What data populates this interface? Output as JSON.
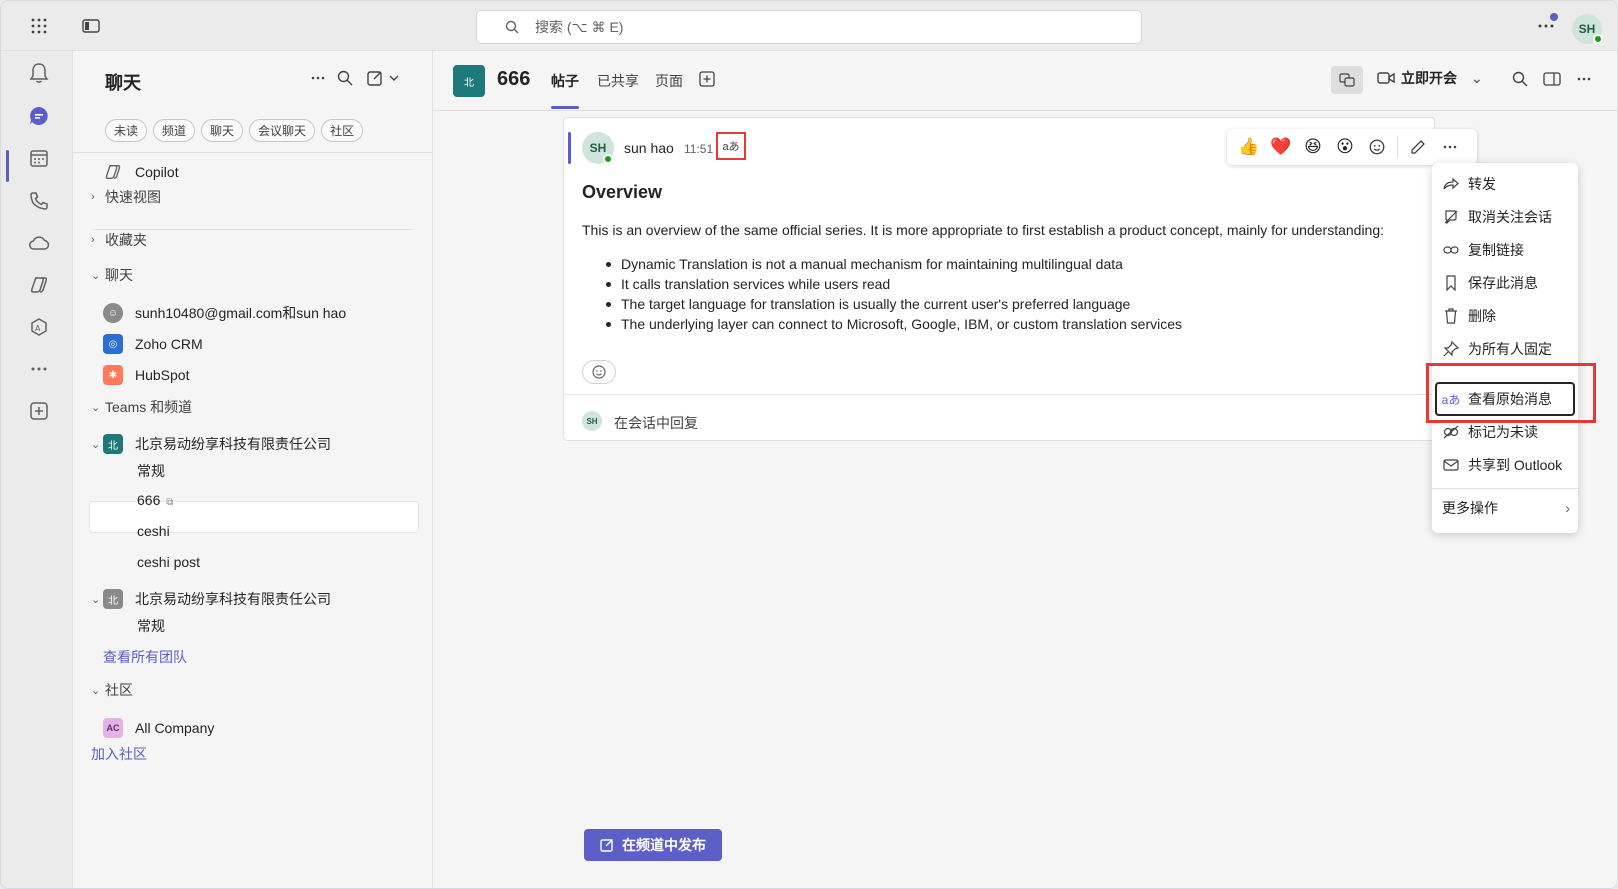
{
  "titlebar": {
    "search_placeholder": "搜索 (⌥ ⌘ E)",
    "user_initials": "SH"
  },
  "left_pane": {
    "title": "聊天",
    "filters": [
      "未读",
      "频道",
      "聊天",
      "会议聊天",
      "社区"
    ],
    "copilot": "Copilot",
    "quick_views": "快速视图",
    "favorites": "收藏夹",
    "chats_section": "聊天",
    "chats": [
      {
        "label": "sunh10480@gmail.com和sun hao"
      },
      {
        "label": "Zoho CRM"
      },
      {
        "label": "HubSpot"
      }
    ],
    "teams_section": "Teams 和频道",
    "team1": {
      "name": "北京易动纷享科技有限责任公司",
      "badge": "北"
    },
    "team1_channels": [
      "常规",
      "666",
      "ceshi",
      "ceshi post"
    ],
    "team2": {
      "name": "北京易动纷享科技有限责任公司",
      "badge": "北"
    },
    "team2_channels": [
      "常规"
    ],
    "see_all_teams": "查看所有团队",
    "community_section": "社区",
    "community": {
      "name": "All Company",
      "badge": "AC"
    },
    "join_community": "加入社区"
  },
  "channel": {
    "badge": "北",
    "name": "666",
    "tabs": [
      "帖子",
      "已共享",
      "页面"
    ],
    "meet_now": "立即开会"
  },
  "post": {
    "author_initials": "SH",
    "author": "sun hao",
    "time": "11:51",
    "title": "Overview",
    "intro": "This is an overview of the same official series. It is more appropriate to first establish a product concept, mainly for understanding:",
    "bullets": [
      "Dynamic Translation is not a manual mechanism for maintaining multilingual data",
      "It calls translation services while users read",
      "The target language for translation is usually the current user's preferred language",
      "The underlying layer can connect to Microsoft, Google, IBM, or custom translation services"
    ],
    "reply_initials": "SH",
    "reply_label": "在会话中回复"
  },
  "reactions": [
    "👍",
    "❤️",
    "😆",
    "😮"
  ],
  "context_menu": {
    "items": [
      "转发",
      "取消关注会话",
      "复制链接",
      "保存此消息",
      "删除",
      "为所有人固定",
      "查看原始消息",
      "标记为未读",
      "共享到 Outlook"
    ],
    "more": "更多操作"
  },
  "compose": {
    "post_button": "在频道中发布"
  },
  "colors": {
    "accent": "#5b5fc7",
    "highlight": "#e53935",
    "presence": "#13a10e"
  }
}
